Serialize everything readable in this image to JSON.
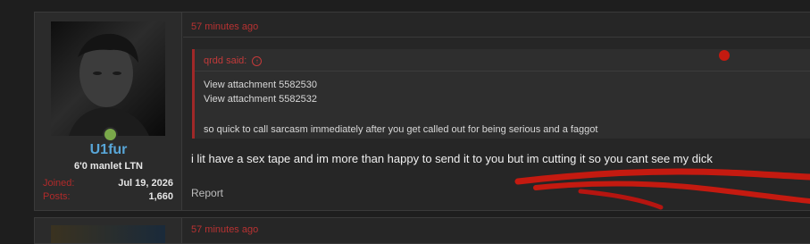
{
  "post": {
    "user": {
      "username": "U1fur",
      "title": "6'0 manlet LTN",
      "joined_label": "Joined:",
      "joined_value": "Jul 19, 2026",
      "posts_label": "Posts:",
      "posts_value": "1,660"
    },
    "timestamp": "57 minutes ago",
    "quote": {
      "author": "qrdd said:",
      "attachments": [
        "View attachment 5582530",
        "View attachment 5582532"
      ],
      "text": "so quick to call sarcasm immediately after you get called out for being serious and a faggot"
    },
    "message": "i lit have a sex tape and im more than happy to send it to you but im cutting it so you cant see my dick",
    "report_label": "Report"
  },
  "next_post": {
    "timestamp": "57 minutes ago"
  },
  "colors": {
    "accent_red": "#b83232",
    "username_blue": "#58a6d8",
    "online_green": "#7aa84a",
    "scribble_red": "#c41a10"
  }
}
